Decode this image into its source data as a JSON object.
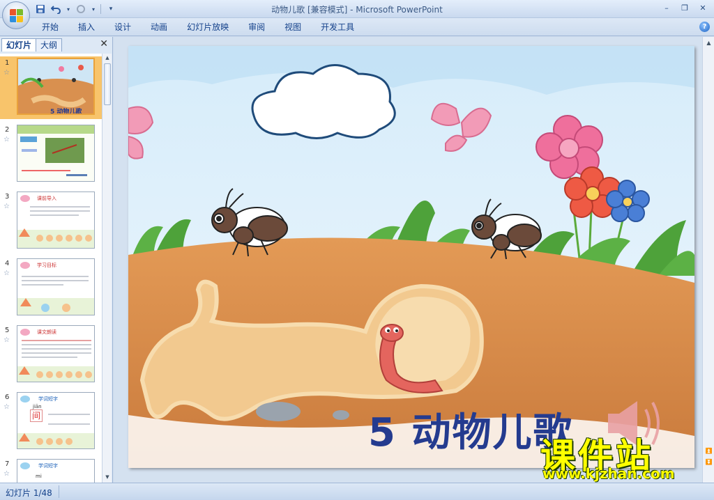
{
  "window": {
    "title": "动物儿歌 [兼容模式] - Microsoft PowerPoint",
    "controls": {
      "minimize": "–",
      "restore": "❐",
      "close": "✕"
    }
  },
  "qat": {
    "save_icon": "save-icon",
    "undo_icon": "undo-icon",
    "redo_icon": "redo-icon"
  },
  "ribbon": {
    "tabs": [
      {
        "label": "开始"
      },
      {
        "label": "插入"
      },
      {
        "label": "设计"
      },
      {
        "label": "动画"
      },
      {
        "label": "幻灯片放映"
      },
      {
        "label": "审阅"
      },
      {
        "label": "视图"
      },
      {
        "label": "开发工具"
      }
    ],
    "help": "?"
  },
  "left_pane": {
    "tabs": [
      {
        "label": "幻灯片"
      },
      {
        "label": "大纲"
      }
    ],
    "close": "✕",
    "slides": [
      {
        "number": "1",
        "star": "☆",
        "selected": true,
        "caption": "5 动物儿歌"
      },
      {
        "number": "2",
        "star": "☆",
        "selected": false
      },
      {
        "number": "3",
        "star": "☆",
        "selected": false,
        "caption": "课前导入"
      },
      {
        "number": "4",
        "star": "☆",
        "selected": false,
        "caption": "学习目标"
      },
      {
        "number": "5",
        "star": "☆",
        "selected": false,
        "caption": "课文朗读"
      },
      {
        "number": "6",
        "star": "☆",
        "selected": false,
        "caption": "学词短字",
        "pinyin": "jiān",
        "char": "间"
      },
      {
        "number": "7",
        "star": "☆",
        "selected": false,
        "caption": "学词短字",
        "pinyin": "mi"
      }
    ]
  },
  "slide": {
    "title": "5 动物儿歌",
    "speaker_icon": "speaker-icon"
  },
  "watermark": {
    "main": "课件站",
    "url": "www.kjzhan.com"
  },
  "status": {
    "slide_counter": "幻灯片 1/48"
  },
  "colors": {
    "accent": "#15428b",
    "title_blue": "#243b8f",
    "selected_thumb": "#f8c46b"
  }
}
